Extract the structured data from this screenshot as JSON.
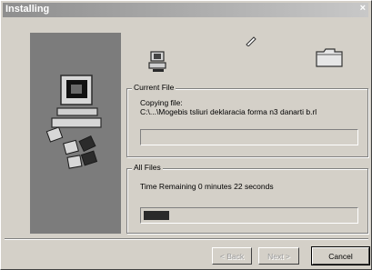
{
  "window": {
    "title": "Installing",
    "close_glyph": "×"
  },
  "current_file": {
    "group_label": "Current File",
    "status_line": "Copying file:",
    "file_path": "C:\\...\\Mogebis tsliuri deklaracia forma n3 danarti b.rl",
    "progress_fraction": 0.0
  },
  "all_files": {
    "group_label": "All Files",
    "time_remaining": "Time Remaining 0 minutes 22 seconds",
    "progress_fraction": 0.12
  },
  "buttons": {
    "back": "< Back",
    "next": "Next >",
    "cancel": "Cancel"
  },
  "icons": {
    "side": "computer-with-floppies-icon",
    "source": "install-computer-icon",
    "flying": "flying-file-icon",
    "target": "folder-icon"
  }
}
